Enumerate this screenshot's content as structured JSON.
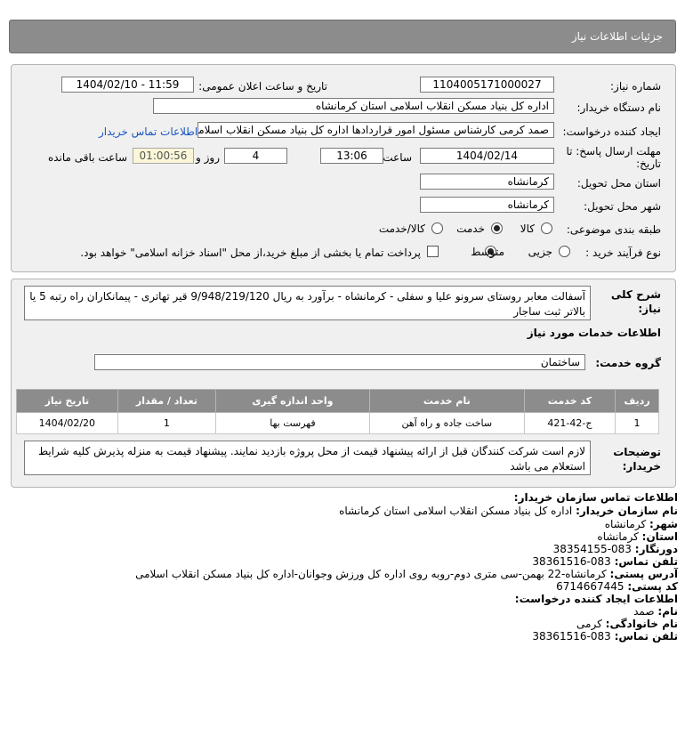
{
  "header": {
    "title": "جزئیات اطلاعات نیاز"
  },
  "form": {
    "need_number_label": "شماره نیاز:",
    "need_number": "1104005171000027",
    "announce_label": "تاریخ و ساعت اعلان عمومی:",
    "announce_value": "1404/02/10 - 11:59",
    "buyer_org_label": "نام دستگاه خریدار:",
    "buyer_org": "اداره کل بنیاد مسکن انقلاب اسلامی استان کرمانشاه",
    "requester_label": "ایجاد کننده درخواست:",
    "requester": "صمد کرمی کارشناس مسئول امور قراردادها اداره کل بنیاد مسکن انقلاب اسلامی",
    "contact_link": "اطلاعات تماس خریدار",
    "deadline_label_1": "مهلت ارسال پاسخ: تا",
    "deadline_label_2": "تاریخ:",
    "deadline_date": "1404/02/14",
    "time_label": "ساعت",
    "deadline_time": "13:06",
    "days_value": "4",
    "days_label": "روز و",
    "remaining_time": "01:00:56",
    "remaining_label": "ساعت باقی مانده",
    "province_label": "استان محل تحویل:",
    "province": "کرمانشاه",
    "city_label": "شهر محل تحویل:",
    "city": "کرمانشاه",
    "category_label": "طبقه بندی موضوعی:",
    "category_options": [
      "کالا",
      "خدمت",
      "کالا/خدمت"
    ],
    "category_selected": 1,
    "process_label": "نوع فرآیند خرید :",
    "process_options": [
      "جزیی",
      "متوسط"
    ],
    "process_selected": 1,
    "payment_note": "پرداخت تمام یا بخشی از مبلغ خرید،از محل \"اسناد خزانه اسلامی\" خواهد بود."
  },
  "summary": {
    "label_1": "شرح کلی",
    "label_2": "نیاز:",
    "text": "آسفالت معابر روستای سرونو علیا و سفلی - کرمانشاه - برآورد به ریال 9/948/219/120 قیر تهاتری - پیمانکاران راه رتبه 5 یا بالاتر ثبت ساجار"
  },
  "services": {
    "section_title": "اطلاعات خدمات مورد نیاز",
    "group_label": "گروه خدمت:",
    "group_value": "ساختمان",
    "columns": [
      "ردیف",
      "کد خدمت",
      "نام خدمت",
      "واحد اندازه گیری",
      "تعداد / مقدار",
      "تاریخ نیاز"
    ],
    "rows": [
      [
        "1",
        "ج-42-421",
        "ساخت جاده و راه آهن",
        "فهرست بها",
        "1",
        "1404/02/20"
      ]
    ]
  },
  "notes": {
    "label_1": "توضیحات",
    "label_2": "خریدار:",
    "text": "لازم است شرکت کنندگان قبل از ارائه پیشنهاد قیمت از محل پروژه بازدید نمایند. پیشنهاد قیمت به منزله پذیرش کلیه شرایط استعلام می باشد"
  },
  "contact": {
    "title": "اطلاعات تماس سازمان خریدار:",
    "org_label": "نام سازمان خریدار:",
    "org_value": "اداره کل بنیاد مسکن انقلاب اسلامی استان کرمانشاه",
    "city_label": "شهر:",
    "city_value": "کرمانشاه",
    "province_label": "استان:",
    "province_value": "کرمانشاه",
    "fax_label": "دورنگار:",
    "fax_value": "083-38354155",
    "phone_label": "تلفن تماس:",
    "phone_value": "083-38361516",
    "address_label": "آدرس پستی:",
    "address_value": "کرمانشاه-22 بهمن-سی متری دوم-روبه روی اداره کل ورزش وجوانان-اداره کل بنیاد مسکن انقلاب اسلامی",
    "postal_label": "کد پستی:",
    "postal_value": "6714667445",
    "creator_title": "اطلاعات ایجاد کننده درخواست:",
    "name_label": "نام:",
    "name_value": "صمد",
    "family_label": "نام خانوادگی:",
    "family_value": "کرمی",
    "creator_phone_label": "تلفن تماس:",
    "creator_phone_value": "083-38361516"
  }
}
